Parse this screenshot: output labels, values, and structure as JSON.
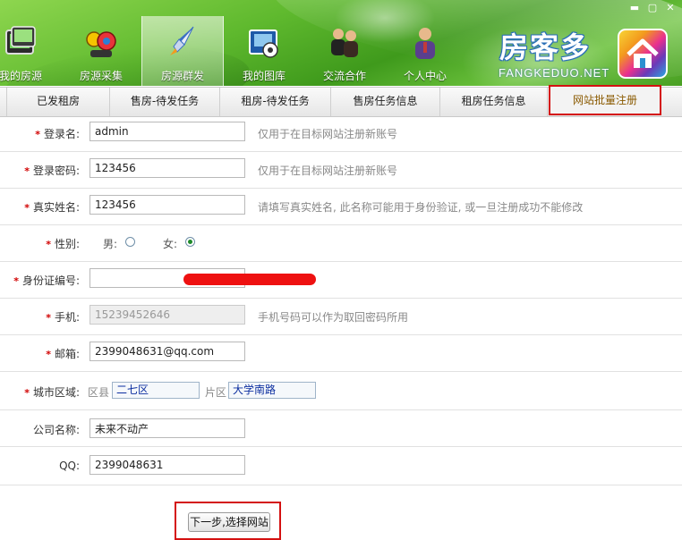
{
  "window": {
    "buttons": [
      "▬",
      "▢",
      "✕"
    ]
  },
  "nav": {
    "items": [
      {
        "label": "我的房源",
        "icon": "monitor-stack-icon"
      },
      {
        "label": "房源采集",
        "icon": "robot-toy-icon"
      },
      {
        "label": "房源群发",
        "icon": "rocket-icon",
        "active": true
      },
      {
        "label": "我的图库",
        "icon": "photo-album-icon"
      },
      {
        "label": "交流合作",
        "icon": "people-icon"
      },
      {
        "label": "个人中心",
        "icon": "user-icon"
      }
    ]
  },
  "logo": {
    "title": "房客多",
    "subtitle": "FANGKEDUO.NET"
  },
  "tabs": [
    {
      "label": "已发租房"
    },
    {
      "label": "售房-待发任务"
    },
    {
      "label": "租房-待发任务"
    },
    {
      "label": "售房任务信息"
    },
    {
      "label": "租房任务信息"
    },
    {
      "label": "网站批量注册",
      "active": true
    }
  ],
  "form": {
    "username": {
      "label": "登录名:",
      "value": "admin",
      "hint": "仅用于在目标网站注册新账号"
    },
    "password": {
      "label": "登录密码:",
      "value": "123456",
      "hint": "仅用于在目标网站注册新账号"
    },
    "realname": {
      "label": "真实姓名:",
      "value": "123456",
      "hint": "请填写真实姓名, 此名称可能用于身份验证, 或一旦注册成功不能修改"
    },
    "gender": {
      "label": "性别:",
      "male": "男:",
      "female": "女:",
      "selected": "female"
    },
    "idcard": {
      "label": "身份证编号:"
    },
    "phone": {
      "label": "手机:",
      "value": "15239452646",
      "hint": "手机号码可以作为取回密码所用"
    },
    "email": {
      "label": "邮箱:",
      "value": "2399048631@qq.com"
    },
    "city": {
      "label": "城市区域:",
      "county_label": "区县",
      "county_value": "二七区",
      "area_label": "片区",
      "area_value": "大学南路"
    },
    "company": {
      "label": "公司名称:",
      "value": "未来不动产"
    },
    "qq": {
      "label": "QQ:",
      "value": "2399048631"
    },
    "submit": "下一步,选择网站"
  },
  "colors": {
    "highlight_border": "#d41111",
    "required_star": "#d10000",
    "header_green": "#5fb92e"
  }
}
